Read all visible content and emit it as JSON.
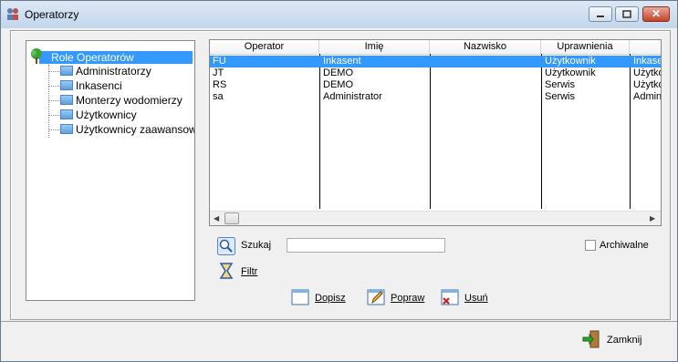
{
  "window": {
    "title": "Operatorzy"
  },
  "tree": {
    "root": "Role Operatorów",
    "items": [
      "Administratorzy",
      "Inkasenci",
      "Monterzy wodomierzy",
      "Użytkownicy",
      "Użytkownicy zaawansow"
    ]
  },
  "grid": {
    "columns": [
      "Operator",
      "Imię",
      "Nazwisko",
      "Uprawnienia",
      ""
    ],
    "rows": [
      {
        "operator": "FU",
        "imie": "Inkasent",
        "nazwisko": "",
        "uprawnienia": "Użytkownik",
        "extra": "Inkase"
      },
      {
        "operator": "JT",
        "imie": "DEMO",
        "nazwisko": "",
        "uprawnienia": "Użytkownik",
        "extra": "Użytko"
      },
      {
        "operator": "RS",
        "imie": "DEMO",
        "nazwisko": "",
        "uprawnienia": "Serwis",
        "extra": "Użytko"
      },
      {
        "operator": "sa",
        "imie": "Administrator",
        "nazwisko": "",
        "uprawnienia": "Serwis",
        "extra": "Admini"
      }
    ],
    "selected_row": 0
  },
  "search": {
    "label": "Szukaj",
    "value": ""
  },
  "filter": {
    "label": "Filtr"
  },
  "archive": {
    "label": "Archiwalne",
    "checked": false
  },
  "actions": {
    "add": "Dopisz",
    "edit": "Popraw",
    "delete": "Usuń"
  },
  "footer": {
    "close": "Zamknij"
  },
  "colors": {
    "selection": "#3399ff",
    "titlebar": "#c2d6ec"
  }
}
